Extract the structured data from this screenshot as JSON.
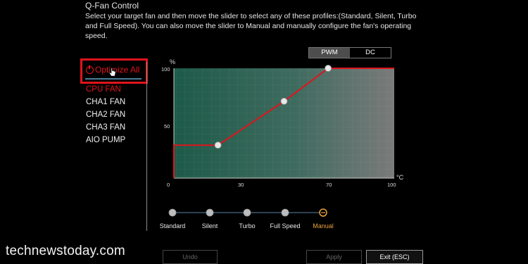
{
  "header": {
    "title": "Q-Fan Control",
    "description": "Select your target fan and then move the slider to select any of these profiles:(Standard, Silent, Turbo and Full Speed). You can also move the slider to Manual and manually configure the fan's operating speed."
  },
  "sidebar": {
    "optimize_label": "Optimize All",
    "fans": [
      {
        "label": "CPU FAN",
        "active": true
      },
      {
        "label": "CHA1 FAN",
        "active": false
      },
      {
        "label": "CHA2 FAN",
        "active": false
      },
      {
        "label": "CHA3 FAN",
        "active": false
      },
      {
        "label": "AIO PUMP",
        "active": false
      }
    ]
  },
  "mode_toggle": {
    "options": [
      "PWM",
      "DC"
    ],
    "selected": "PWM"
  },
  "fan_curve": {
    "y_unit": "%",
    "x_unit": "°C",
    "y_ticks": [
      "100",
      "50"
    ],
    "x_ticks": [
      "0",
      "30",
      "70",
      "100"
    ],
    "points": [
      {
        "temp": 20,
        "speed": 30
      },
      {
        "temp": 50,
        "speed": 70
      },
      {
        "temp": 70,
        "speed": 100
      }
    ],
    "curve_color": "#e0141c"
  },
  "profiles": {
    "options": [
      "Standard",
      "Silent",
      "Turbo",
      "Full Speed",
      "Manual"
    ],
    "selected": "Manual",
    "active_color": "#e8a23a"
  },
  "watermark": "technewstoday.com",
  "footer": {
    "undo_label": "Undo",
    "apply_label": "Apply",
    "exit_label": "Exit (ESC)"
  }
}
